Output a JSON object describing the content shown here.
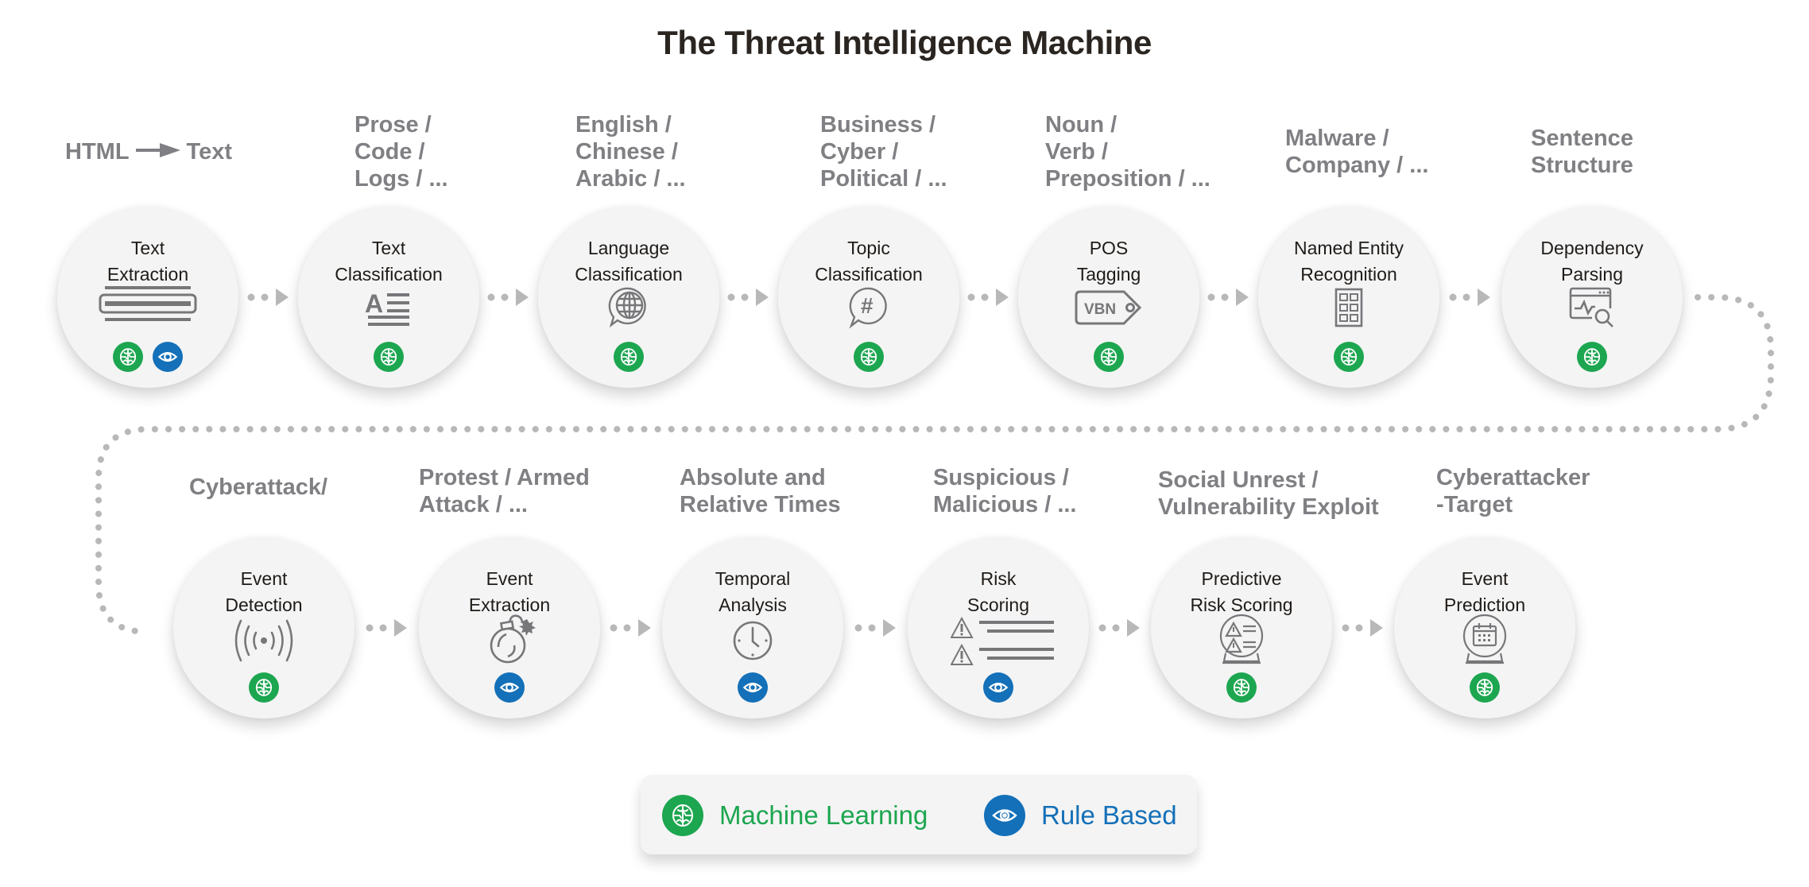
{
  "title": "The Threat Intelligence Machine",
  "colors": {
    "machine_learning": "#1da650",
    "rule_based": "#1470b8",
    "node_fill": "#f4f4f4",
    "header_text": "#808084",
    "connector": "#b8b8b8",
    "icon_stroke": "#77777a"
  },
  "legend": {
    "machine_learning_label": "Machine Learning",
    "rule_based_label": "Rule Based"
  },
  "nodes": [
    {
      "id": "text-extraction",
      "label": [
        "Text",
        "Extraction"
      ],
      "header": [
        "HTML",
        "Text"
      ],
      "header_kind": "arrow",
      "icon": "text-extraction-icon",
      "methods": [
        "ml",
        "rb"
      ]
    },
    {
      "id": "text-classification",
      "label": [
        "Text",
        "Classification"
      ],
      "header": [
        "Prose /",
        "Code /",
        "Logs / ..."
      ],
      "icon": "text-classification-icon",
      "methods": [
        "ml"
      ]
    },
    {
      "id": "language-classification",
      "label": [
        "Language",
        "Classification"
      ],
      "header": [
        "English /",
        "Chinese /",
        "Arabic / ..."
      ],
      "icon": "globe-speech-icon",
      "methods": [
        "ml"
      ]
    },
    {
      "id": "topic-classification",
      "label": [
        "Topic",
        "Classification"
      ],
      "header": [
        "Business /",
        "Cyber /",
        "Political / ..."
      ],
      "icon": "hashtag-speech-icon",
      "methods": [
        "ml"
      ]
    },
    {
      "id": "pos-tagging",
      "label": [
        "POS",
        "Tagging"
      ],
      "header": [
        "Noun /",
        "Verb /",
        "Preposition / ..."
      ],
      "icon": "tag-icon",
      "icon_text": "VBN",
      "methods": [
        "ml"
      ]
    },
    {
      "id": "named-entity-recognition",
      "label": [
        "Named Entity",
        "Recognition"
      ],
      "header": [
        "Malware /",
        "Company / ..."
      ],
      "icon": "grid-icon",
      "methods": [
        "ml"
      ]
    },
    {
      "id": "dependency-parsing",
      "label": [
        "Dependency",
        "Parsing"
      ],
      "header": [
        "Sentence",
        "Structure"
      ],
      "icon": "browser-search-icon",
      "methods": [
        "ml"
      ]
    },
    {
      "id": "event-detection",
      "label": [
        "Event",
        "Detection"
      ],
      "header": [
        "Cyberattack/"
      ],
      "icon": "broadcast-icon",
      "methods": [
        "ml"
      ]
    },
    {
      "id": "event-extraction",
      "label": [
        "Event",
        "Extraction"
      ],
      "header": [
        "Protest / Armed",
        "Attack / ..."
      ],
      "icon": "bomb-icon",
      "methods": [
        "rb"
      ]
    },
    {
      "id": "temporal-analysis",
      "label": [
        "Temporal",
        "Analysis"
      ],
      "header": [
        "Absolute and",
        "Relative Times"
      ],
      "icon": "clock-icon",
      "methods": [
        "rb"
      ]
    },
    {
      "id": "risk-scoring",
      "label": [
        "Risk",
        "Scoring"
      ],
      "header": [
        "Suspicious /",
        "Malicious / ..."
      ],
      "icon": "warning-list-icon",
      "methods": [
        "rb"
      ]
    },
    {
      "id": "predictive-risk-scoring",
      "label": [
        "Predictive",
        "Risk Scoring"
      ],
      "header": [
        "Social Unrest /",
        "Vulnerability Exploit"
      ],
      "icon": "crystal-ball-warning-icon",
      "methods": [
        "ml"
      ]
    },
    {
      "id": "event-prediction",
      "label": [
        "Event",
        "Prediction"
      ],
      "header": [
        "Cyberattacker",
        "-Target"
      ],
      "icon": "crystal-ball-calendar-icon",
      "methods": [
        "ml"
      ]
    }
  ]
}
